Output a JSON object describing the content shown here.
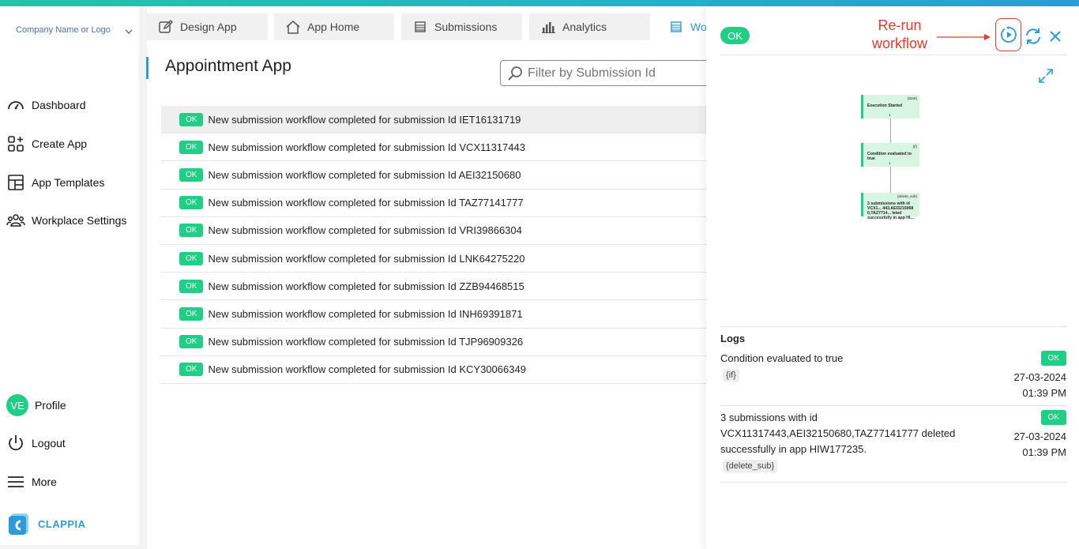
{
  "sidebar": {
    "company_label": "Company Name or Logo",
    "items": [
      {
        "label": "Dashboard"
      },
      {
        "label": "Create App"
      },
      {
        "label": "App Templates"
      },
      {
        "label": "Workplace Settings"
      }
    ],
    "profile": {
      "initials": "VE",
      "label": "Profile"
    },
    "logout_label": "Logout",
    "more_label": "More",
    "brand": "CLAPPIA"
  },
  "tabs": [
    {
      "label": "Design App"
    },
    {
      "label": "App Home"
    },
    {
      "label": "Submissions"
    },
    {
      "label": "Analytics"
    },
    {
      "label": "Wor"
    }
  ],
  "main": {
    "title": "Appointment App",
    "filter_placeholder": "Filter by Submission Id",
    "status_label": "OK",
    "rows": [
      "New submission workflow completed for submission Id IET16131719",
      "New submission workflow completed for submission Id VCX11317443",
      "New submission workflow completed for submission Id AEI32150680",
      "New submission workflow completed for submission Id TAZ77141777",
      "New submission workflow completed for submission Id VRI39866304",
      "New submission workflow completed for submission Id LNK64275220",
      "New submission workflow completed for submission Id ZZB94468515",
      "New submission workflow completed for submission Id INH69391871",
      "New submission workflow completed for submission Id TJP96909326",
      "New submission workflow completed for submission Id KCY30066349"
    ]
  },
  "panel": {
    "status": "OK",
    "annotation": "Re-run workflow",
    "flow": {
      "nodes": [
        {
          "tag": "{Start}",
          "text": "Execution Started"
        },
        {
          "tag": "{if}",
          "text": "Condition evaluated to true"
        },
        {
          "tag": "{delete_sub}",
          "text": "3 submissions with id VCX1... 443,AEI3215068 0,TAZ7714... leted successfully in app HI..."
        }
      ],
      "edge_label": "1"
    },
    "logs_title": "Logs",
    "logs": [
      {
        "message": "Condition evaluated to true",
        "tag": "{if}",
        "status": "OK",
        "date": "27-03-2024",
        "time": "01:39 PM"
      },
      {
        "message": "3 submissions with id VCX11317443,AEI32150680,TAZ77141777 deleted successfully in app HIW177235.",
        "tag": "{delete_sub}",
        "status": "OK",
        "date": "27-03-2024",
        "time": "01:39 PM"
      }
    ]
  },
  "colors": {
    "accent": "#1fcf86",
    "brand": "#2f9ad8",
    "annotation": "#e8392d"
  }
}
